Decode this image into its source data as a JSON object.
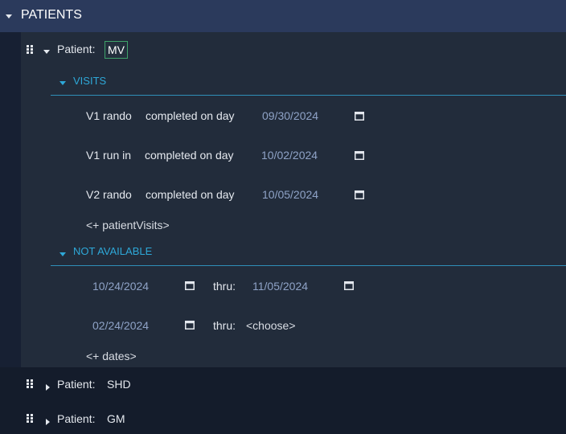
{
  "header": {
    "title": "PATIENTS"
  },
  "patients": [
    {
      "label": "Patient:",
      "name": "MV"
    },
    {
      "label": "Patient:",
      "name": "SHD"
    },
    {
      "label": "Patient:",
      "name": "GM"
    }
  ],
  "visits": {
    "title": "VISITS",
    "rows": [
      {
        "name": "V1 rando",
        "status": "completed on day",
        "date": "09/30/2024"
      },
      {
        "name": "V1 run in",
        "status": "completed on day",
        "date": "10/02/2024"
      },
      {
        "name": "V2 rando",
        "status": "completed on day",
        "date": "10/05/2024"
      }
    ],
    "add_label": "<+ patientVisits>"
  },
  "not_available": {
    "title": "NOT AVAILABLE",
    "rows": [
      {
        "from": "10/24/2024",
        "thru_label": "thru:",
        "to": "11/05/2024"
      },
      {
        "from": "02/24/2024",
        "thru_label": "thru:",
        "to": "<choose>"
      }
    ],
    "add_label": "<+ dates>"
  },
  "icons": {
    "collapse": "caret-down-icon",
    "expand": "caret-right-icon",
    "drag": "drag-handle-icon",
    "calendar": "calendar-icon"
  },
  "colors": {
    "background": "#141c2b",
    "header": "#2b3a5c",
    "panel": "#222c3b",
    "section_accent": "#2ea8d8",
    "date_text": "#8fa3c7",
    "focus_border": "#3fa36a"
  }
}
